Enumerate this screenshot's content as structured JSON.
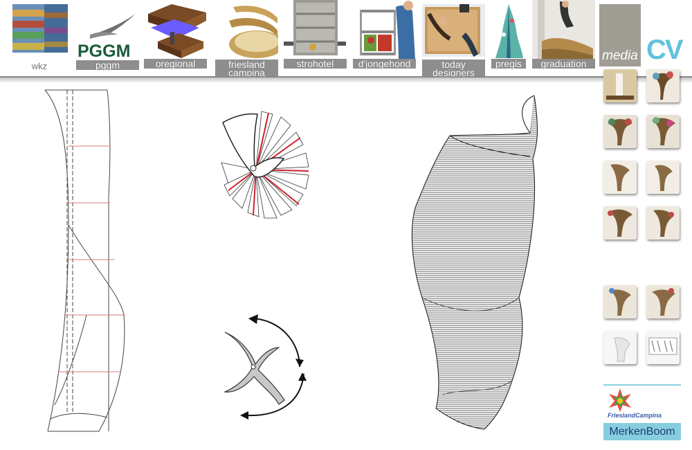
{
  "nav": [
    {
      "id": "wkz",
      "label": "wkz",
      "style": "gray"
    },
    {
      "id": "pggm",
      "label": "pggm",
      "logo_text": "PGGM"
    },
    {
      "id": "oregional",
      "label": "oregional"
    },
    {
      "id": "friesland",
      "label": "friesland campina"
    },
    {
      "id": "strohotel",
      "label": "strohotel"
    },
    {
      "id": "djongehond",
      "label": "d'jongehond"
    },
    {
      "id": "today",
      "label": "today designers"
    },
    {
      "id": "pregis",
      "label": "pregis"
    },
    {
      "id": "graduation",
      "label": "graduation"
    }
  ],
  "media_label": "media",
  "cv_label": "CV",
  "side_logos": {
    "frieslandcampina": "FrieslandCampina",
    "merkenboom": "MerkenBoom"
  },
  "colors": {
    "accent_cv": "#5fc3dc",
    "nav_label_bg": "#8e8e8e",
    "red_line": "#cc1f2a",
    "media_bg": "#a09d95"
  }
}
